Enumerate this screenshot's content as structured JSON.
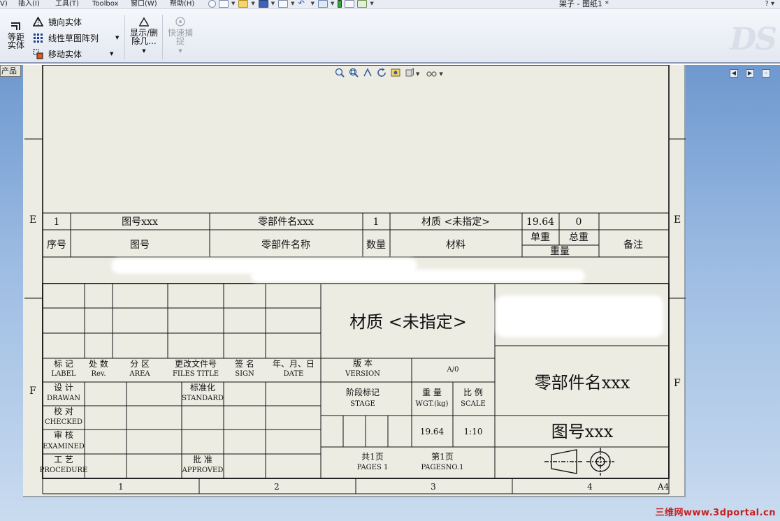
{
  "menu": {
    "items": [
      "V)",
      "插入(I)",
      "工具(T)",
      "Toolbox",
      "窗口(W)",
      "帮助(H)"
    ]
  },
  "window": {
    "title": "架子 - 图纸1 *",
    "controls": "?  ▾"
  },
  "ribbon": {
    "offset_surface": "等距实体",
    "mirror_entities": "镜向实体",
    "linear_pattern": "线性草图阵列",
    "move_entities": "移动实体",
    "show_delete": "显示/删除几...",
    "quick_snap": "快速捕捉",
    "logo": "DS"
  },
  "workspace": {
    "left_tab": "产品",
    "watermark": "三维网www.3dportal.cn"
  },
  "drawing": {
    "zone_rows": [
      "E",
      "F"
    ],
    "zone_cols": [
      "1",
      "2",
      "3",
      "4"
    ],
    "sheet_size": "A4",
    "bom": {
      "row": {
        "index": "1",
        "drawing_no": "图号xxx",
        "part_name": "零部件名xxx",
        "qty": "1",
        "material": "材质 <未指定>",
        "unit_weight": "19.64",
        "total_weight": "0",
        "notes": ""
      },
      "headers": {
        "index": "序号",
        "drawing_no": "图号",
        "part_name": "零部件名称",
        "qty": "数量",
        "material": "材料",
        "unit_weight": "单重",
        "total_weight": "总重",
        "weight": "重量",
        "notes": "备注"
      }
    },
    "title_block": {
      "material": "材质 <未指定>",
      "part_name": "零部件名xxx",
      "drawing_no": "图号xxx",
      "rev_headers": [
        {
          "cn": "标 记",
          "en": "LABEL"
        },
        {
          "cn": "处 数",
          "en": "Rev."
        },
        {
          "cn": "分 区",
          "en": "AREA"
        },
        {
          "cn": "更改文件号",
          "en": "FILES TITLE"
        },
        {
          "cn": "签 名",
          "en": "SIGN"
        },
        {
          "cn": "年、月、日",
          "en": "DATE"
        }
      ],
      "roles": [
        {
          "cn": "设 计",
          "en": "DRAWAN"
        },
        {
          "cn": "校 对",
          "en": "CHECKED"
        },
        {
          "cn": "审 核",
          "en": "EXAMINED"
        },
        {
          "cn": "工 艺",
          "en": "PROCEDURE"
        }
      ],
      "standard": {
        "cn": "标准化",
        "en": "STANDARD"
      },
      "approved": {
        "cn": "批 准",
        "en": "APPROVED"
      },
      "version": {
        "cn": "版 本",
        "en": "VERSION",
        "value": "A/0"
      },
      "stage": {
        "cn": "阶段标记",
        "en": "STAGE"
      },
      "weight": {
        "cn": "重 量",
        "en": "WGT.(kg)",
        "value": "19.64"
      },
      "scale": {
        "cn": "比 例",
        "en": "SCALE",
        "value": "1:10"
      },
      "pages": {
        "cn": "共1页",
        "en": "PAGES 1"
      },
      "page_no": {
        "cn": "第1页",
        "en": "PAGESNO.1"
      }
    }
  }
}
